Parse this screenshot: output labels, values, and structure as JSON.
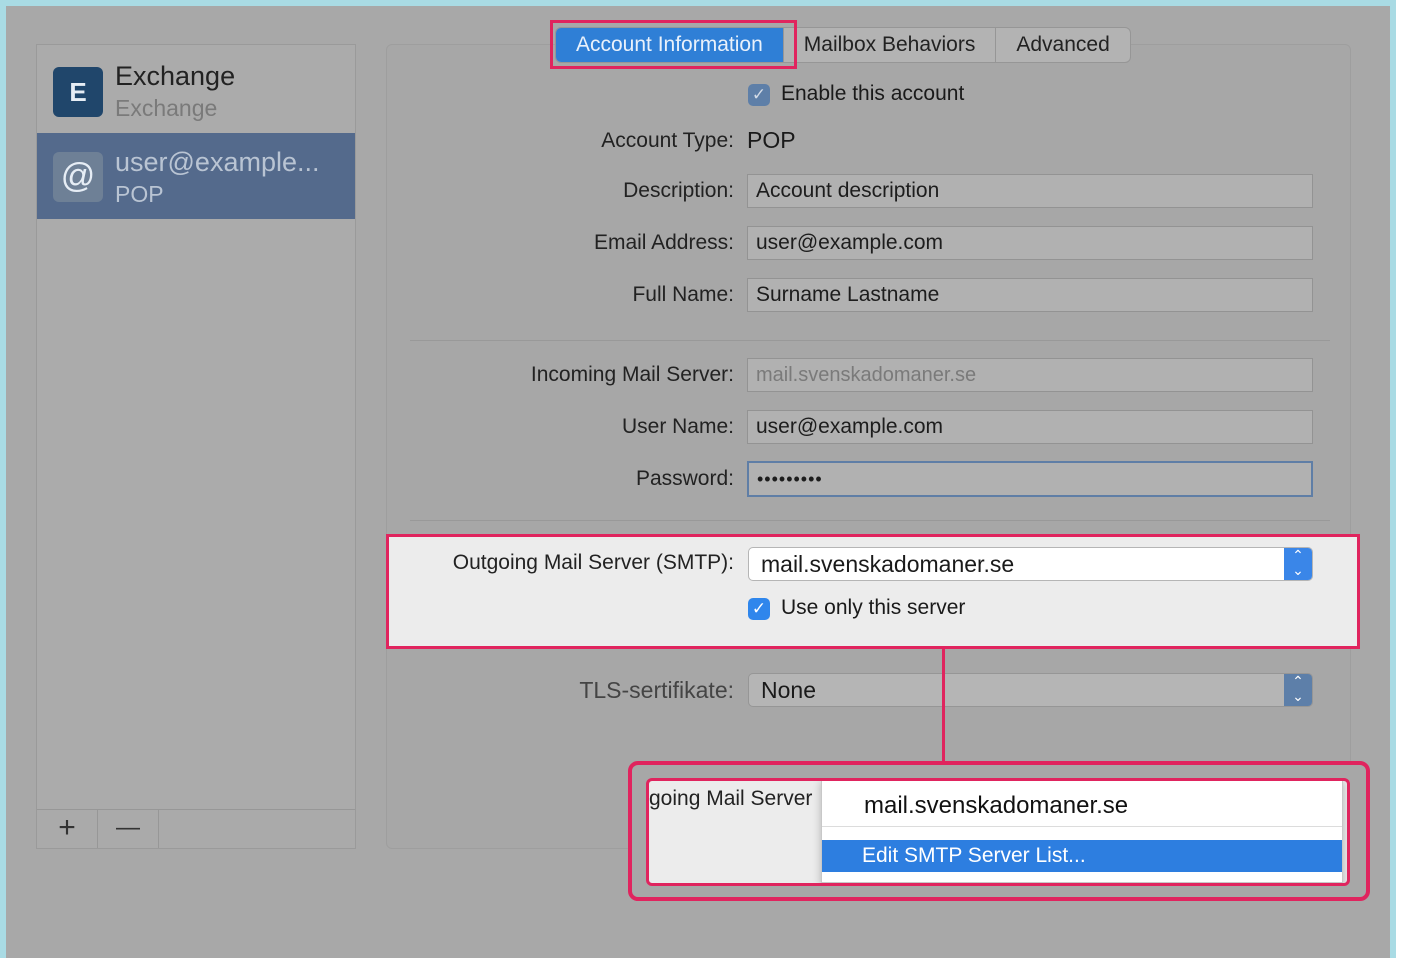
{
  "sidebar": {
    "accounts": [
      {
        "title": "Exchange",
        "subtitle": "Exchange",
        "icon": "exchange-icon",
        "icon_text": "E"
      },
      {
        "title": "user@example...",
        "subtitle": "POP",
        "icon": "at-sign-icon",
        "icon_text": "@"
      }
    ],
    "add_label": "+",
    "remove_label": "—"
  },
  "tabs": [
    {
      "label": "Account Information",
      "active": true
    },
    {
      "label": "Mailbox Behaviors",
      "active": false
    },
    {
      "label": "Advanced",
      "active": false
    }
  ],
  "form": {
    "enable_label": "Enable this account",
    "enable_checked": true,
    "account_type_label": "Account Type:",
    "account_type_value": "POP",
    "description_label": "Description:",
    "description_value": "Account description",
    "email_label": "Email Address:",
    "email_value": "user@example.com",
    "fullname_label": "Full Name:",
    "fullname_value": "Surname Lastname",
    "incoming_label": "Incoming Mail Server:",
    "incoming_value": "mail.svenskadomaner.se",
    "username_label": "User Name:",
    "username_value": "user@example.com",
    "password_label": "Password:",
    "password_value": "•••••••••",
    "smtp_label": "Outgoing Mail Server (SMTP):",
    "smtp_value": "mail.svenskadomaner.se",
    "use_only_label": "Use only this server",
    "use_only_checked": true,
    "tls_label": "TLS-sertifikate:",
    "tls_value": "None"
  },
  "zoom": {
    "partial_label": "going Mail Server",
    "menu_selected": "mail.svenskadomaner.se",
    "menu_highlighted": "Edit SMTP Server List..."
  },
  "colors": {
    "highlight": "#e0245e",
    "accent": "#2f7fd6"
  }
}
